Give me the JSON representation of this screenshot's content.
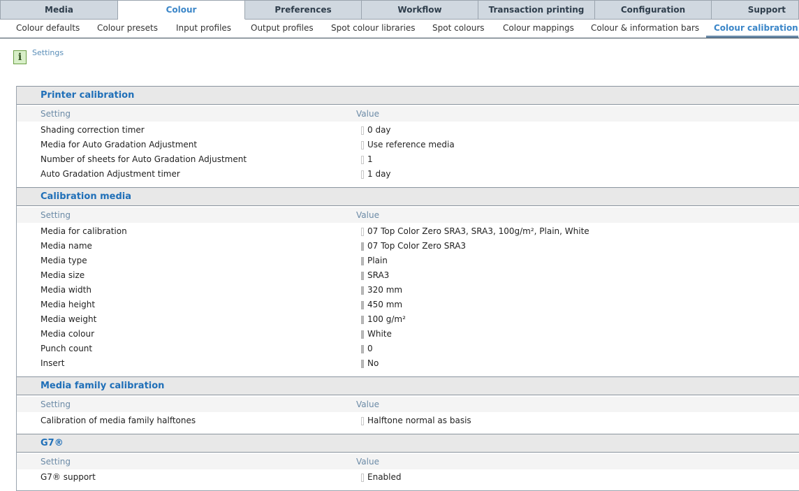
{
  "main_tabs": [
    {
      "label": "Media"
    },
    {
      "label": "Colour"
    },
    {
      "label": "Preferences"
    },
    {
      "label": "Workflow"
    },
    {
      "label": "Transaction printing"
    },
    {
      "label": "Configuration"
    },
    {
      "label": "Support"
    }
  ],
  "sub_tabs": [
    {
      "label": "Colour defaults"
    },
    {
      "label": "Colour presets"
    },
    {
      "label": "Input profiles"
    },
    {
      "label": "Output profiles"
    },
    {
      "label": "Spot colour libraries"
    },
    {
      "label": "Spot colours"
    },
    {
      "label": "Colour mappings"
    },
    {
      "label": "Colour & information bars"
    },
    {
      "label": "Colour calibration"
    }
  ],
  "info": {
    "settings_label": "Settings",
    "icon": "info-icon"
  },
  "columns": {
    "setting": "Setting",
    "value": "Value"
  },
  "sections": [
    {
      "title": "Printer calibration",
      "rows": [
        {
          "label": "Shading correction timer",
          "value": "0 day"
        },
        {
          "label": "Media for Auto Gradation Adjustment",
          "value": "Use reference media"
        },
        {
          "label": "Number of sheets for Auto Gradation Adjustment",
          "value": "1"
        },
        {
          "label": "Auto Gradation Adjustment timer",
          "value": "1 day"
        }
      ]
    },
    {
      "title": "Calibration media",
      "rows": [
        {
          "label": "Media for calibration",
          "value": "07 Top Color Zero SRA3, SRA3, 100g/m², Plain, White"
        },
        {
          "label": "Media name",
          "value": "07 Top Color Zero SRA3"
        },
        {
          "label": "Media type",
          "value": "Plain"
        },
        {
          "label": "Media size",
          "value": "SRA3"
        },
        {
          "label": "Media width",
          "value": "320 mm"
        },
        {
          "label": "Media height",
          "value": "450 mm"
        },
        {
          "label": "Media weight",
          "value": "100 g/m²"
        },
        {
          "label": "Media colour",
          "value": "White"
        },
        {
          "label": "Punch count",
          "value": "0"
        },
        {
          "label": "Insert",
          "value": "No"
        }
      ]
    },
    {
      "title": "Media family calibration",
      "rows": [
        {
          "label": "Calibration of media family halftones",
          "value": "Halftone normal as basis"
        }
      ]
    },
    {
      "title": "G7®",
      "rows": [
        {
          "label": "G7® support",
          "value": "Enabled"
        }
      ]
    }
  ],
  "colors": {
    "accent": "#3b86c8",
    "section_title": "#1f6fb8",
    "tab_bg": "#d0d8e0",
    "info_green": "#d8efc8"
  }
}
